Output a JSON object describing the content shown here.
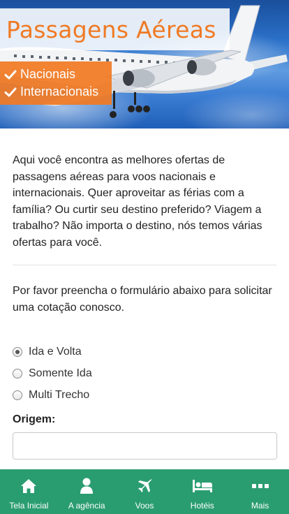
{
  "hero": {
    "title": "Passagens Aéreas",
    "badges": [
      "Nacionais",
      "Internacionais"
    ]
  },
  "intro_text": "Aqui você encontra as melhores ofertas de passagens aéreas para voos nacionais e internacionais. Quer aproveitar as férias com a família? Ou curtir seu destino preferido? Viagem a trabalho? Não importa o destino, nós temos várias ofertas para você.",
  "form_note": "Por favor preencha o formulário abaixo para solicitar uma cotação conosco.",
  "trip_type": {
    "options": [
      "Ida e Volta",
      "Somente Ida",
      "Multi Trecho"
    ],
    "selected": "Ida e Volta"
  },
  "origin": {
    "label": "Origem:",
    "value": "",
    "placeholder": ""
  },
  "bottom_nav": {
    "items": [
      {
        "label": "Tela Inicial",
        "icon": "home-icon"
      },
      {
        "label": "A agência",
        "icon": "user-icon"
      },
      {
        "label": "Voos",
        "icon": "plane-icon"
      },
      {
        "label": "Hotéis",
        "icon": "bed-icon"
      },
      {
        "label": "Mais",
        "icon": "more-icon"
      }
    ]
  },
  "colors": {
    "accent_orange": "#f07a24",
    "nav_green": "#2a9d70"
  }
}
